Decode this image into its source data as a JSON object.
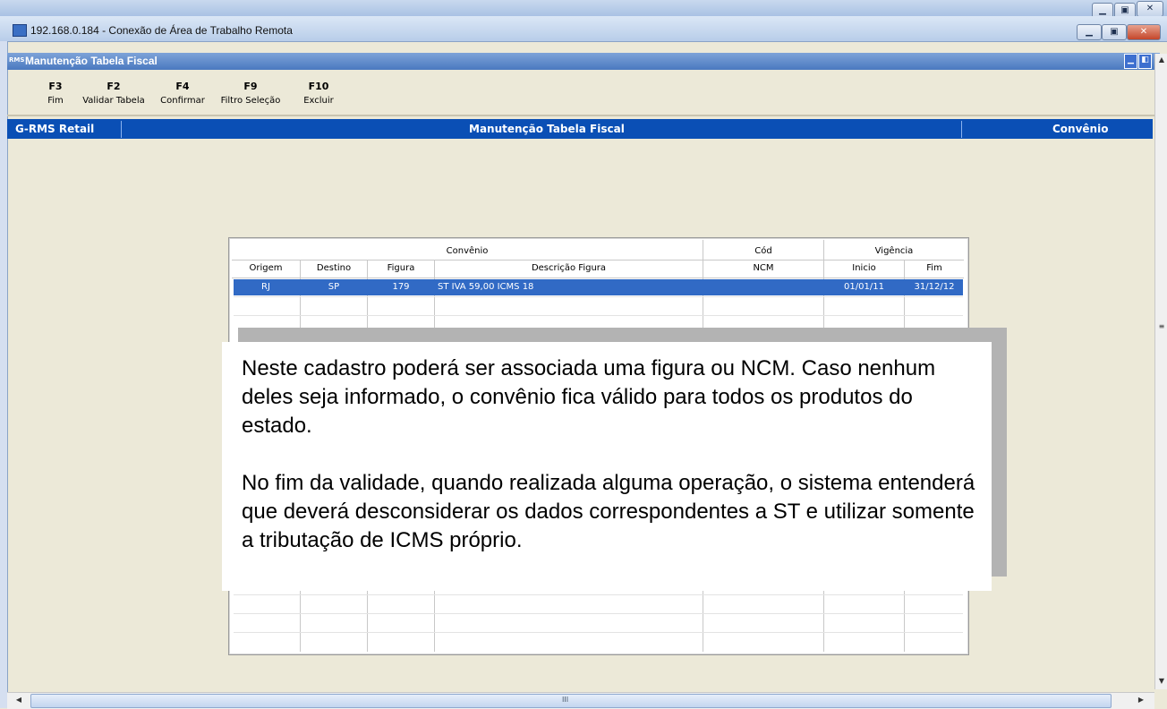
{
  "rdp": {
    "title": "192.168.0.184 - Conexão de Área de Trabalho Remota"
  },
  "app": {
    "title": "Manutenção Tabela Fiscal",
    "icon_text": "RMS"
  },
  "toolbar": {
    "items": [
      {
        "key": "F3",
        "label": "Fim"
      },
      {
        "key": "F2",
        "label": "Validar Tabela"
      },
      {
        "key": "F4",
        "label": "Confirmar"
      },
      {
        "key": "F9",
        "label": "Filtro Seleção"
      },
      {
        "key": "F10",
        "label": "Excluir"
      }
    ]
  },
  "header": {
    "left": "G-RMS Retail",
    "center": "Manutenção Tabela Fiscal",
    "right": "Convênio"
  },
  "grid": {
    "group_headers": {
      "convenio": "Convênio",
      "cod": "Cód",
      "vigencia": "Vigência"
    },
    "columns": [
      "Origem",
      "Destino",
      "Figura",
      "Descrição Figura",
      "NCM",
      "Inicio",
      "Fim"
    ],
    "rows": [
      {
        "origem": "RJ",
        "destino": "SP",
        "figura": "179",
        "descricao": "ST IVA 59,00 ICMS 18",
        "ncm": "",
        "inicio": "01/01/11",
        "fim": "31/12/12"
      }
    ]
  },
  "tooltip": {
    "paragraph1": "Neste cadastro poderá ser associada uma figura ou NCM. Caso nenhum deles seja informado, o convênio fica válido para todos os produtos do estado.",
    "paragraph2": "No fim da validade, quando realizada alguma operação, o sistema entenderá que deverá desconsiderar os dados correspondentes a ST e utilizar somente a tributação de ICMS próprio."
  },
  "scrollbar": {
    "thumb_glyph": "III"
  },
  "colors": {
    "header_blue": "#0a4fb5",
    "selection_blue": "#316ac5",
    "window_bg": "#ece9d8"
  }
}
